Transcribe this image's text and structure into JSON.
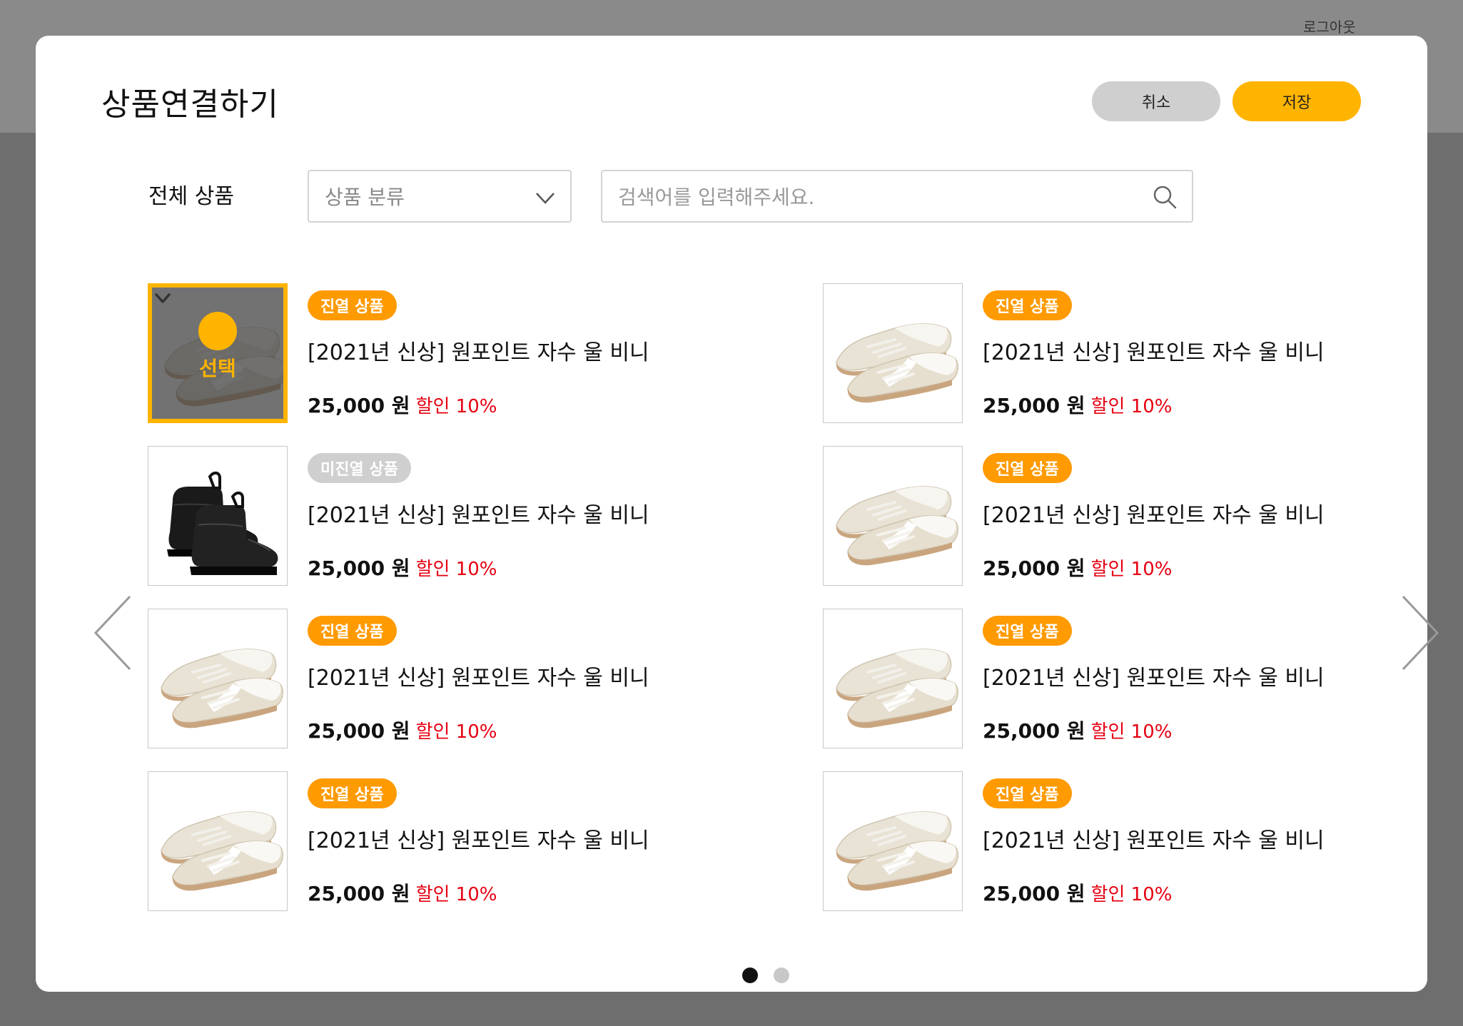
{
  "header": {
    "logout_label": "로그아웃"
  },
  "modal": {
    "title": "상품연결하기",
    "cancel_label": "취소",
    "save_label": "저장"
  },
  "filters": {
    "label": "전체 상품",
    "category_placeholder": "상품 분류",
    "search_placeholder": "검색어를 입력해주세요."
  },
  "selection": {
    "overlay_label": "선택"
  },
  "products": [
    {
      "badge": "진열 상품",
      "displayed": true,
      "name": "[2021년 신상]  원포인트 자수 울 비니",
      "price": "25,000 원",
      "discount": "할인 10%",
      "image": "sneaker-image",
      "selected": true
    },
    {
      "badge": "진열 상품",
      "displayed": true,
      "name": "[2021년 신상]  원포인트 자수 울 비니",
      "price": "25,000 원",
      "discount": "할인 10%",
      "image": "sneaker-image",
      "selected": false
    },
    {
      "badge": "미진열 상품",
      "displayed": false,
      "name": "[2021년 신상]  원포인트 자수 울 비니",
      "price": "25,000 원",
      "discount": "할인 10%",
      "image": "boot-image",
      "selected": false
    },
    {
      "badge": "진열 상품",
      "displayed": true,
      "name": "[2021년 신상]  원포인트 자수 울 비니",
      "price": "25,000 원",
      "discount": "할인 10%",
      "image": "sneaker-image",
      "selected": false
    },
    {
      "badge": "진열 상품",
      "displayed": true,
      "name": "[2021년 신상]  원포인트 자수 울 비니",
      "price": "25,000 원",
      "discount": "할인 10%",
      "image": "sneaker-image",
      "selected": false
    },
    {
      "badge": "진열 상품",
      "displayed": true,
      "name": "[2021년 신상]  원포인트 자수 울 비니",
      "price": "25,000 원",
      "discount": "할인 10%",
      "image": "sneaker-image",
      "selected": false
    },
    {
      "badge": "진열 상품",
      "displayed": true,
      "name": "[2021년 신상]  원포인트 자수 울 비니",
      "price": "25,000 원",
      "discount": "할인 10%",
      "image": "sneaker-image",
      "selected": false
    },
    {
      "badge": "진열 상품",
      "displayed": true,
      "name": "[2021년 신상]  원포인트 자수 울 비니",
      "price": "25,000 원",
      "discount": "할인 10%",
      "image": "sneaker-image",
      "selected": false
    }
  ],
  "pagination": {
    "pages": 2,
    "current": 1
  },
  "colors": {
    "accent": "#ffb400",
    "badge_on": "#ff9a00",
    "badge_off": "#cfcfcf",
    "discount": "#e60012"
  }
}
